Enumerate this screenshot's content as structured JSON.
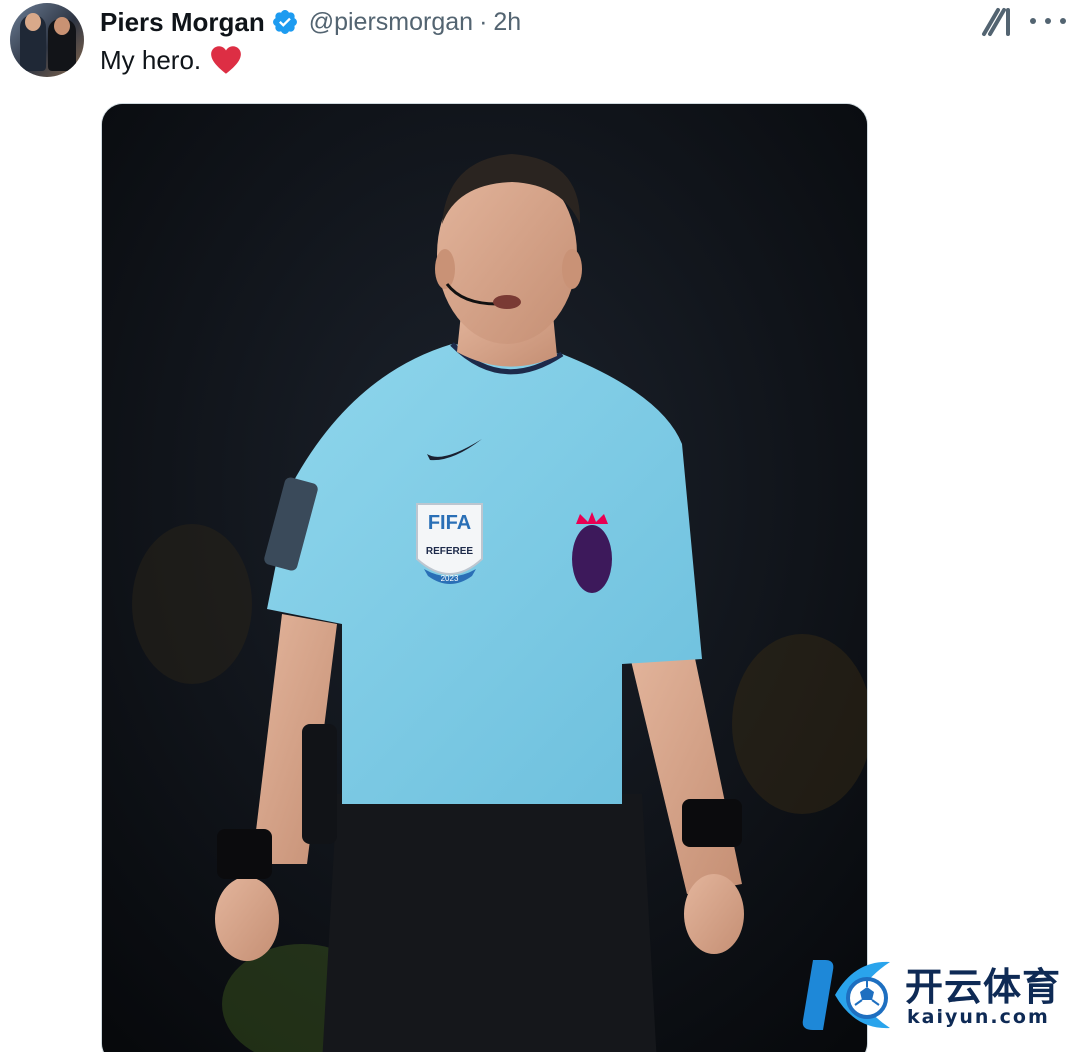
{
  "tweet": {
    "author_name": "Piers Morgan",
    "handle": "@piersmorgan",
    "separator": "·",
    "time": "2h",
    "text": "My hero.",
    "emoji": "heart-emoji",
    "media": {
      "patch_fifa_title": "FIFA",
      "patch_fifa_sub": "REFEREE",
      "patch_fifa_year": "2023"
    }
  },
  "icons": {
    "verified": "verified-badge-icon",
    "grok": "grok-icon",
    "more": "more-options-icon"
  },
  "colors": {
    "verified_blue": "#1d9bf0",
    "text_primary": "#0f1419",
    "text_secondary": "#536471",
    "heart_red": "#e0245e"
  },
  "watermark": {
    "brand_text": "开云体育",
    "url": "kaiyun.com"
  }
}
